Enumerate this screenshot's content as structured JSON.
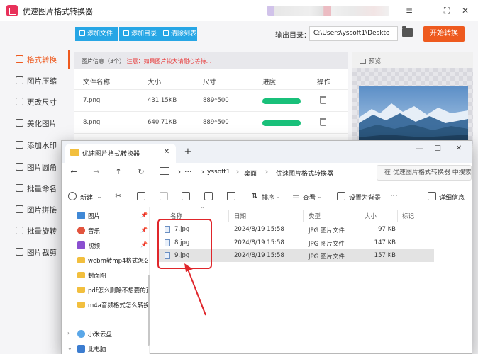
{
  "app": {
    "title": "优速图片格式转换器"
  },
  "window_controls": [
    "≡",
    "—",
    "⛶",
    "✕"
  ],
  "toolbar": {
    "add_file": "添加文件",
    "add_dir": "添加目录",
    "clear_list": "清除列表",
    "output_label": "输出目录：",
    "output_path": "C:\\Users\\yssoft1\\Deskto",
    "start_button": "开始转换"
  },
  "sidebar": {
    "items": [
      {
        "label": "格式转换",
        "active": true
      },
      {
        "label": "图片压缩"
      },
      {
        "label": "更改尺寸"
      },
      {
        "label": "美化图片"
      },
      {
        "label": "添加水印"
      },
      {
        "label": "图片圆角"
      },
      {
        "label": "批量命名"
      },
      {
        "label": "图片拼接"
      },
      {
        "label": "批量旋转"
      },
      {
        "label": "图片裁剪"
      }
    ]
  },
  "file_info": {
    "label": "图片信息（3个）",
    "warning": "注意：如果图片较大请耐心等待..."
  },
  "table": {
    "headers": [
      "文件名称",
      "大小",
      "尺寸",
      "进度",
      "操作"
    ],
    "rows": [
      {
        "name": "7.png",
        "size": "431.15KB",
        "dim": "889*500",
        "progress": 1.0
      },
      {
        "name": "8.png",
        "size": "640.71KB",
        "dim": "889*500",
        "progress": 1.0
      }
    ]
  },
  "preview": {
    "label": "预览"
  },
  "explorer": {
    "tab_title": "优速图片格式转换器",
    "breadcrumb": [
      "yssoft1",
      "桌面",
      "优速图片格式转换器"
    ],
    "search_placeholder": "在 优速图片格式转换器 中搜索",
    "commands": {
      "new": "新建",
      "sort": "排序",
      "view": "查看",
      "set_bg": "设置为背景",
      "details": "详细信息"
    },
    "nav": [
      {
        "label": "图片",
        "pinned": true,
        "icon": "pictures-icon"
      },
      {
        "label": "音乐",
        "pinned": true,
        "icon": "music-icon"
      },
      {
        "label": "视频",
        "pinned": true,
        "icon": "video-icon"
      },
      {
        "label": "webm转mp4格式怎么转换",
        "icon": "folder-icon"
      },
      {
        "label": "封面图",
        "icon": "folder-icon"
      },
      {
        "label": "pdf怎么删除不想要的页",
        "icon": "folder-icon"
      },
      {
        "label": "m4a音频格式怎么转换成",
        "icon": "folder-icon"
      },
      {
        "label": "小米云盘",
        "icon": "cloud-icon"
      },
      {
        "label": "此电脑",
        "icon": "pc-icon"
      }
    ],
    "columns": [
      "名称",
      "日期",
      "类型",
      "大小",
      "标记"
    ],
    "files": [
      {
        "name": "7.jpg",
        "date": "2024/8/19 15:58",
        "type": "JPG 图片文件",
        "size": "97 KB"
      },
      {
        "name": "8.jpg",
        "date": "2024/8/19 15:58",
        "type": "JPG 图片文件",
        "size": "147 KB"
      },
      {
        "name": "9.jpg",
        "date": "2024/8/19 15:58",
        "type": "JPG 图片文件",
        "size": "157 KB",
        "selected": true
      }
    ]
  },
  "colors": {
    "accent": "#ee5a1f",
    "toolbar_button": "#27a6e5",
    "progress": "#19c07a",
    "annotation_red": "#e0262b"
  }
}
